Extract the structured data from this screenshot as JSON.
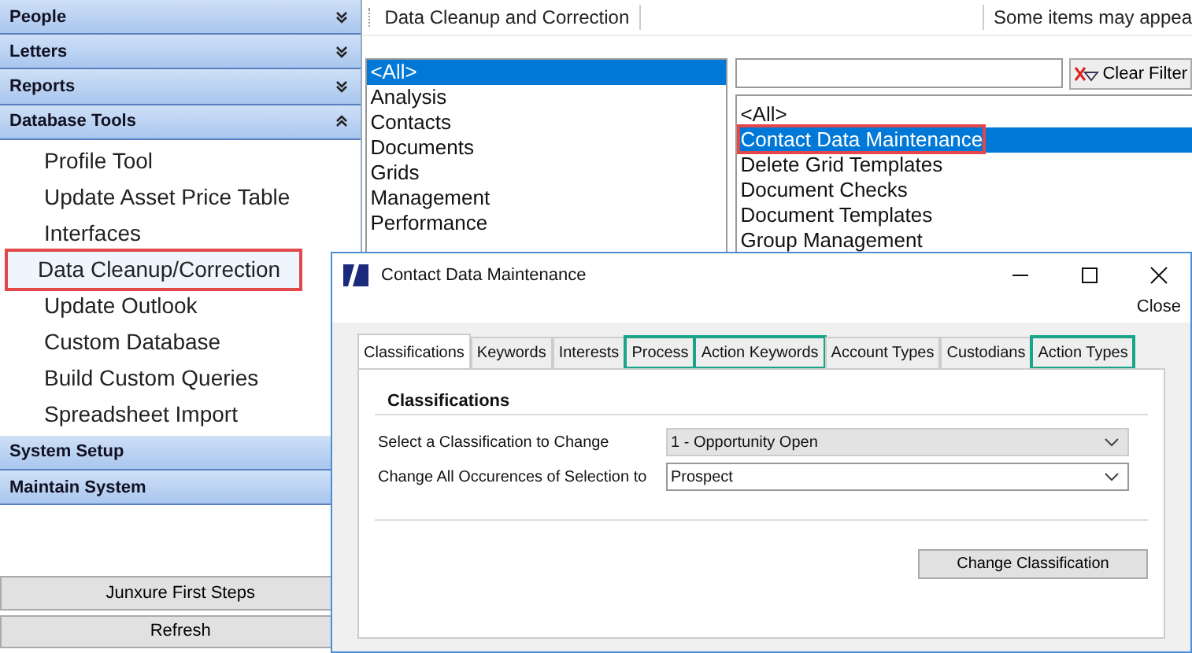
{
  "sidebar": {
    "sections": [
      {
        "label": "People",
        "expanded": false
      },
      {
        "label": "Letters",
        "expanded": false
      },
      {
        "label": "Reports",
        "expanded": false
      },
      {
        "label": "Database Tools",
        "expanded": true,
        "items": [
          {
            "label": "Profile Tool",
            "highlighted": false
          },
          {
            "label": "Update Asset Price Table",
            "highlighted": false
          },
          {
            "label": "Interfaces",
            "highlighted": false
          },
          {
            "label": "Data Cleanup/Correction",
            "highlighted": true
          },
          {
            "label": "Update Outlook",
            "highlighted": false
          },
          {
            "label": "Custom Database",
            "highlighted": false
          },
          {
            "label": "Build Custom Queries",
            "highlighted": false
          },
          {
            "label": "Spreadsheet Import",
            "highlighted": false
          }
        ]
      },
      {
        "label": "System Setup"
      },
      {
        "label": "Maintain System"
      }
    ],
    "buttons": [
      "Junxure First Steps",
      "Refresh"
    ]
  },
  "toolbar": {
    "title": "Data Cleanup and Correction",
    "note": "Some items may appea"
  },
  "categories": [
    {
      "label": "<All>",
      "selected": true
    },
    {
      "label": "Analysis",
      "selected": false
    },
    {
      "label": "Contacts",
      "selected": false
    },
    {
      "label": "Documents",
      "selected": false
    },
    {
      "label": "Grids",
      "selected": false
    },
    {
      "label": "Management",
      "selected": false
    },
    {
      "label": "Performance",
      "selected": false
    }
  ],
  "filter": {
    "button": "Clear Filter"
  },
  "tools": [
    {
      "label": "<All>",
      "selected": false,
      "highlighted": false
    },
    {
      "label": "Contact Data Maintenance",
      "selected": true,
      "highlighted": true
    },
    {
      "label": "Delete Grid Templates",
      "selected": false,
      "highlighted": false
    },
    {
      "label": "Document Checks",
      "selected": false,
      "highlighted": false
    },
    {
      "label": "Document Templates",
      "selected": false,
      "highlighted": false
    },
    {
      "label": "Group Management",
      "selected": false,
      "highlighted": false
    }
  ],
  "dialog": {
    "title": "Contact Data Maintenance",
    "close_label": "Close",
    "tabs": [
      {
        "label": "Classifications",
        "selected": true,
        "highlighted": false
      },
      {
        "label": "Keywords",
        "selected": false,
        "highlighted": false
      },
      {
        "label": "Interests",
        "selected": false,
        "highlighted": false
      },
      {
        "label": "Process",
        "selected": false,
        "highlighted": true
      },
      {
        "label": "Action Keywords",
        "selected": false,
        "highlighted": true
      },
      {
        "label": "Account Types",
        "selected": false,
        "highlighted": false
      },
      {
        "label": "Custodians",
        "selected": false,
        "highlighted": false
      },
      {
        "label": "Action Types",
        "selected": false,
        "highlighted": true
      }
    ],
    "heading": "Classifications",
    "fields": [
      {
        "label": "Select a Classification to Change",
        "value": "1 - Opportunity Open",
        "disabled": true
      },
      {
        "label": "Change All Occurences of Selection to",
        "value": "Prospect",
        "disabled": false
      }
    ],
    "button": "Change Classification"
  }
}
